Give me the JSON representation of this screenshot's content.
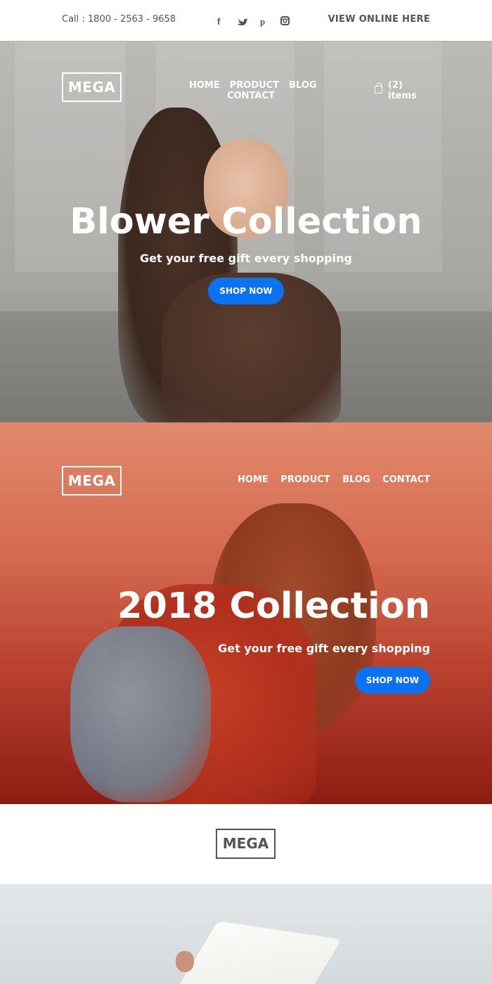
{
  "topbar": {
    "phone": "Call : 1800 - 2563 - 9658",
    "social_icons": [
      "facebook-icon",
      "twitter-icon",
      "pinterest-icon",
      "instagram-icon"
    ],
    "view_online": "VIEW ONLINE HERE"
  },
  "hero1": {
    "logo": "MEGA",
    "nav": {
      "home": "HOME",
      "product": "PRODUCT",
      "blog": "BLOG",
      "contact": "CONTACT"
    },
    "cart": {
      "icon": "shopping-bag-icon",
      "label": "(2) items"
    },
    "headline": "Blower Collection",
    "subheadline": "Get your free gift every shopping",
    "cta": "SHOP NOW"
  },
  "hero2": {
    "logo": "MEGA",
    "nav": {
      "home": "HOME",
      "product": "PRODUCT",
      "blog": "BLOG",
      "contact": "CONTACT"
    },
    "headline": "2018 Collection",
    "subheadline": "Get your free gift every shopping",
    "cta": "SHOP NOW"
  },
  "footer_logo": "MEGA",
  "colors": {
    "accent": "#0b73ef",
    "text_dark": "#555555",
    "white": "#ffffff"
  }
}
